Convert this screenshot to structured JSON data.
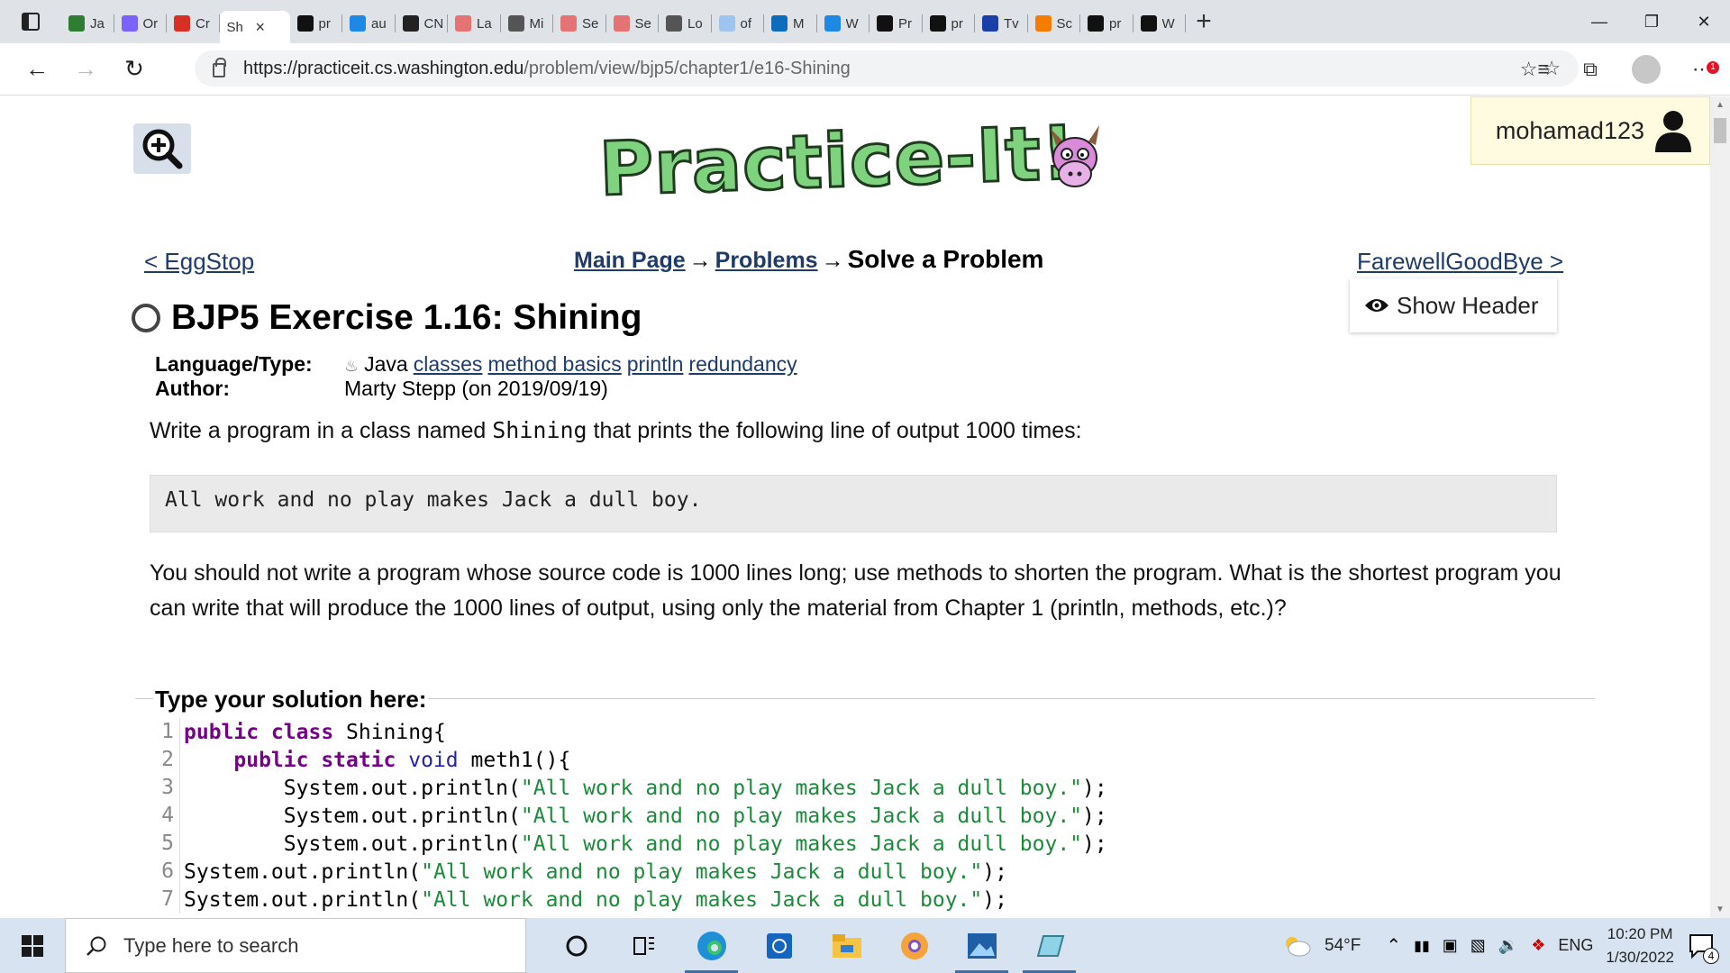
{
  "browser": {
    "tabs": [
      {
        "label": "Ja",
        "icon": "w-icon",
        "color": "#2e7d32"
      },
      {
        "label": "Or",
        "icon": "bolt-icon",
        "color": "#7b61ff"
      },
      {
        "label": "Cr",
        "icon": "gmail-icon",
        "color": "#d93025"
      },
      {
        "label": "pr",
        "icon": "github-icon",
        "color": "#111111"
      },
      {
        "label": "au",
        "icon": "bing-icon",
        "color": "#1e88e5"
      },
      {
        "label": "CN",
        "icon": "m-icon",
        "color": "#222222"
      },
      {
        "label": "La",
        "icon": "pdf-icon",
        "color": "#e57373"
      },
      {
        "label": "Mi",
        "icon": "page-icon",
        "color": "#555555"
      },
      {
        "label": "Se",
        "icon": "pdf-icon",
        "color": "#e57373"
      },
      {
        "label": "Se",
        "icon": "pdf-icon",
        "color": "#e57373"
      },
      {
        "label": "Lo",
        "icon": "page-icon",
        "color": "#555555"
      },
      {
        "label": "of",
        "icon": "bing-icon",
        "color": "#9ec5f0"
      },
      {
        "label": "M",
        "icon": "outlook-icon",
        "color": "#0f6cbd"
      },
      {
        "label": "W",
        "icon": "bing-icon",
        "color": "#1e88e5"
      },
      {
        "label": "Pr",
        "icon": "github-icon",
        "color": "#111111"
      },
      {
        "label": "pr",
        "icon": "github-icon",
        "color": "#111111"
      },
      {
        "label": "Tv",
        "icon": "star-icon",
        "color": "#1a3fa8"
      },
      {
        "label": "Sc",
        "icon": "c-icon",
        "color": "#f57c00"
      },
      {
        "label": "pr",
        "icon": "github-icon",
        "color": "#111111"
      },
      {
        "label": "W",
        "icon": "github-icon",
        "color": "#111111"
      }
    ],
    "active_tab": {
      "label": "Sh",
      "icon": "bing-icon",
      "close": "×"
    },
    "new_tab": "+",
    "url_host": "https://practiceit.cs.washington.edu",
    "url_path": "/problem/view/bjp5/chapter1/e16-Shining",
    "notification_badge": "1"
  },
  "page": {
    "logo_text": "Practice-It!",
    "username": "mohamad123",
    "prev_link": "< EggStop",
    "next_link": "FarewellGoodBye >",
    "crumbs": {
      "main": "Main Page",
      "arrow": "→",
      "problems": "Problems",
      "current": "Solve a Problem"
    },
    "show_header": "Show Header",
    "title": "BJP5 Exercise 1.16: Shining",
    "meta": {
      "language_label": "Language/Type:",
      "language": "Java",
      "tags": [
        "classes",
        "method basics",
        "println",
        "redundancy"
      ],
      "author_label": "Author:",
      "author": "Marty Stepp (on 2019/09/19)"
    },
    "desc_pre": "Write a program in a class named ",
    "desc_code": "Shining",
    "desc_post": " that prints the following line of output 1000 times:",
    "output_line": "All work and no play makes Jack a dull boy.",
    "paragraph": "You should not write a program whose source code is 1000 lines long; use methods to shorten the program. What is the shortest program you can write that will produce the 1000 lines of output, using only the material from Chapter 1 (println, methods, etc.)?",
    "solution_label": "Type your solution here:",
    "code_lines": [
      {
        "n": "1",
        "indent": "",
        "parts": [
          [
            "kw",
            "public class "
          ],
          [
            "pl",
            "Shining{"
          ]
        ]
      },
      {
        "n": "2",
        "indent": "    ",
        "parts": [
          [
            "kw",
            "public static "
          ],
          [
            "ty",
            "void "
          ],
          [
            "pl",
            "meth1(){"
          ]
        ]
      },
      {
        "n": "3",
        "indent": "        ",
        "parts": [
          [
            "pl",
            "System.out.println("
          ],
          [
            "str",
            "\"All work and no play makes Jack a dull boy.\""
          ],
          [
            "pl",
            ");"
          ]
        ]
      },
      {
        "n": "4",
        "indent": "        ",
        "parts": [
          [
            "pl",
            "System.out.println("
          ],
          [
            "str",
            "\"All work and no play makes Jack a dull boy.\""
          ],
          [
            "pl",
            ");"
          ]
        ]
      },
      {
        "n": "5",
        "indent": "        ",
        "parts": [
          [
            "pl",
            "System.out.println("
          ],
          [
            "str",
            "\"All work and no play makes Jack a dull boy.\""
          ],
          [
            "pl",
            ");"
          ]
        ]
      },
      {
        "n": "6",
        "indent": "",
        "parts": [
          [
            "pl",
            "System.out.println("
          ],
          [
            "str",
            "\"All work and no play makes Jack a dull boy.\""
          ],
          [
            "pl",
            ");"
          ]
        ]
      },
      {
        "n": "7",
        "indent": "",
        "parts": [
          [
            "pl",
            "System.out.println("
          ],
          [
            "str",
            "\"All work and no play makes Jack a dull boy.\""
          ],
          [
            "pl",
            ");"
          ]
        ]
      }
    ]
  },
  "taskbar": {
    "search_placeholder": "Type here to search",
    "weather": "54°F",
    "language": "ENG",
    "time": "10:20 PM",
    "date": "1/30/2022",
    "notification_count": "4"
  }
}
